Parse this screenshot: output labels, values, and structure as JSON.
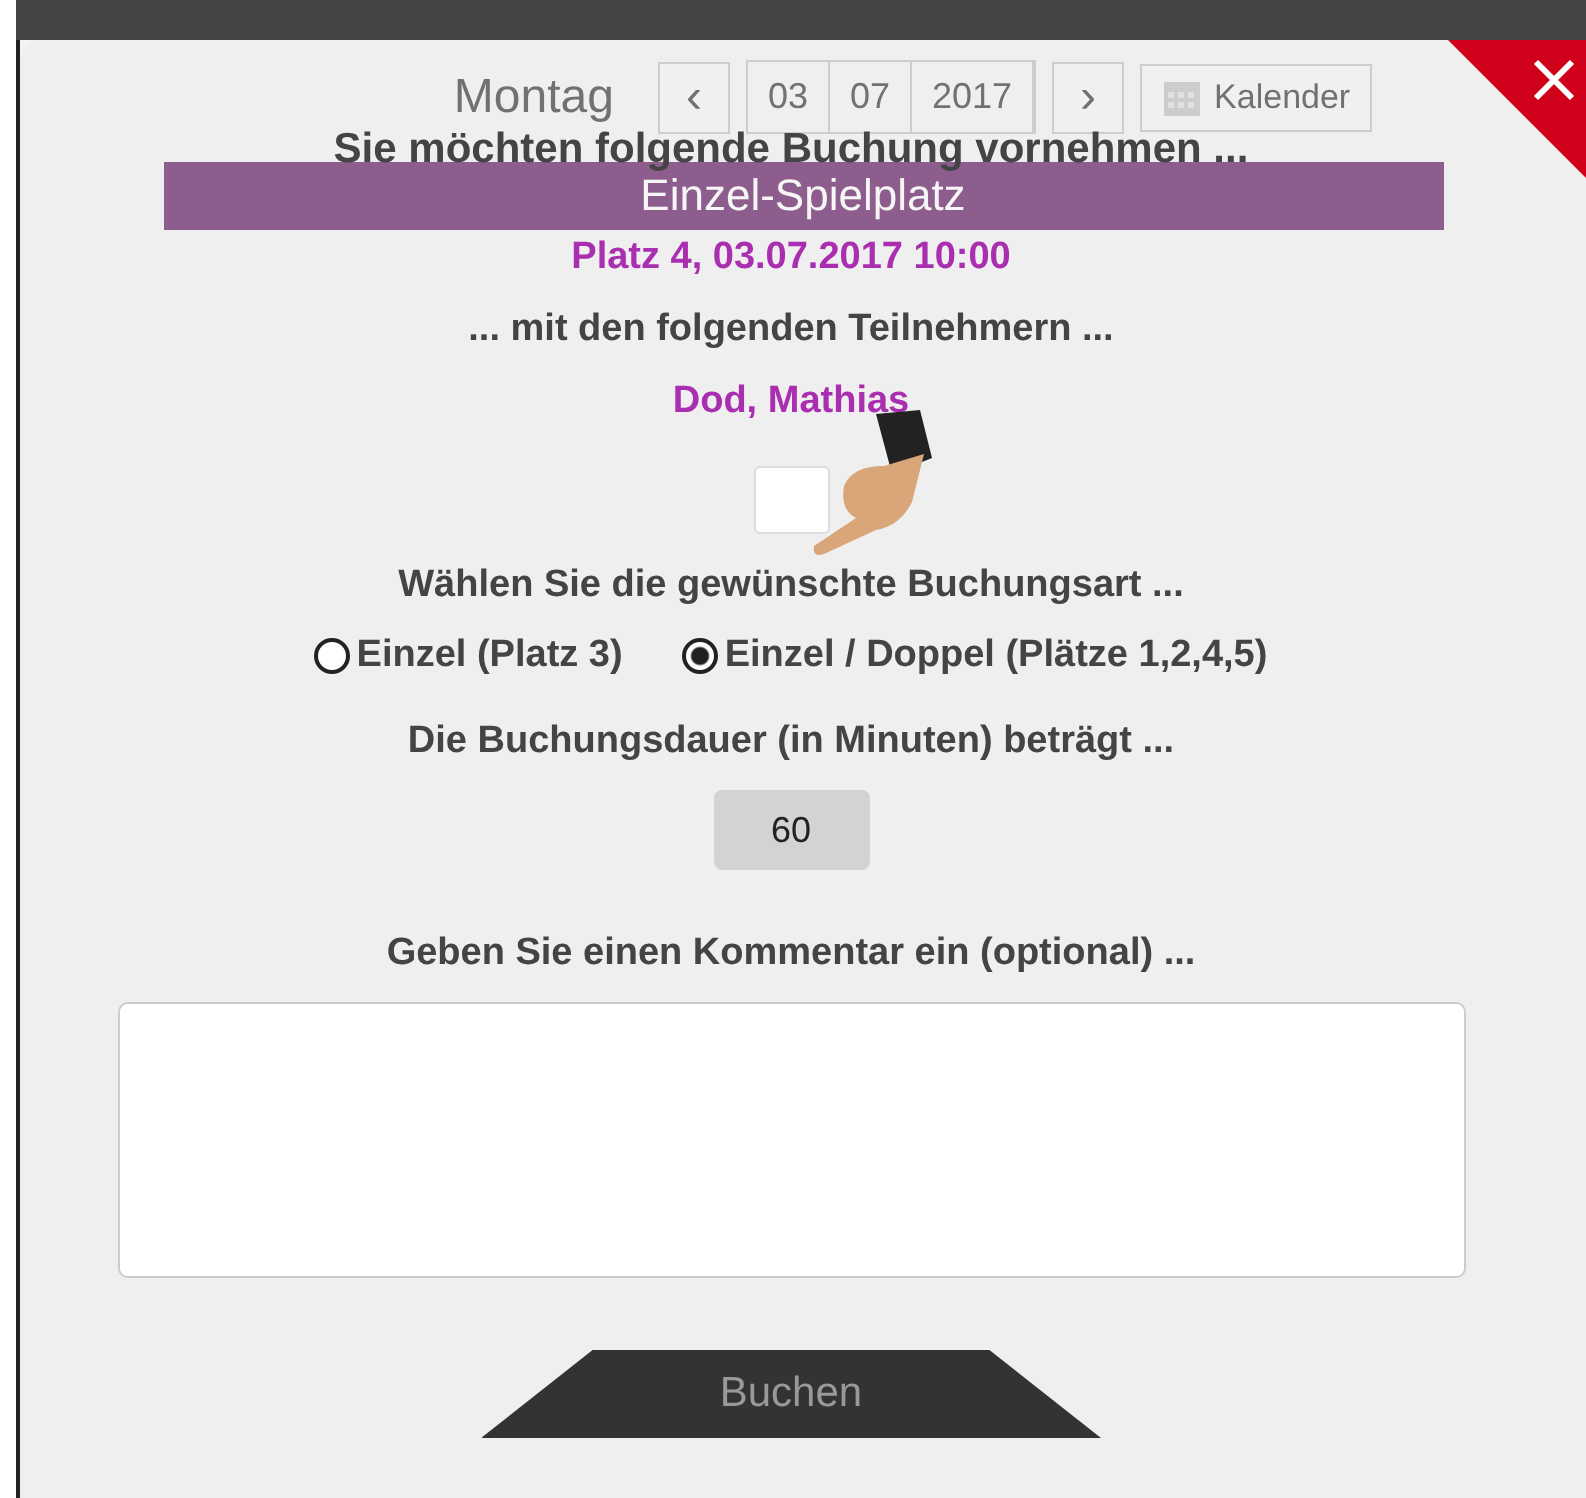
{
  "background": {
    "day": "Montag",
    "prev": "‹",
    "date_parts": [
      "03",
      "07",
      "2017"
    ],
    "next": "›",
    "calendar_button": "Kalender",
    "court_title": "Einzel-Spielplatz"
  },
  "dialog": {
    "heading": "Sie möchten folgende Buchung vornehmen ...",
    "booking": "Platz 4, 03.07.2017 10:00",
    "participants_heading": "... mit den folgenden Teilnehmern ...",
    "participants": [
      "Dod, Mathias"
    ],
    "type_heading": "Wählen Sie die gewünschte Buchungsart ...",
    "booking_types": [
      {
        "label": "Einzel (Platz 3)",
        "selected": false
      },
      {
        "label": "Einzel / Doppel (Plätze 1,2,4,5)",
        "selected": true
      }
    ],
    "duration_heading": "Die Buchungsdauer (in Minuten) beträgt ...",
    "duration": "60",
    "comment_heading": "Geben Sie einen Kommentar ein (optional) ...",
    "submit": "Buchen"
  }
}
